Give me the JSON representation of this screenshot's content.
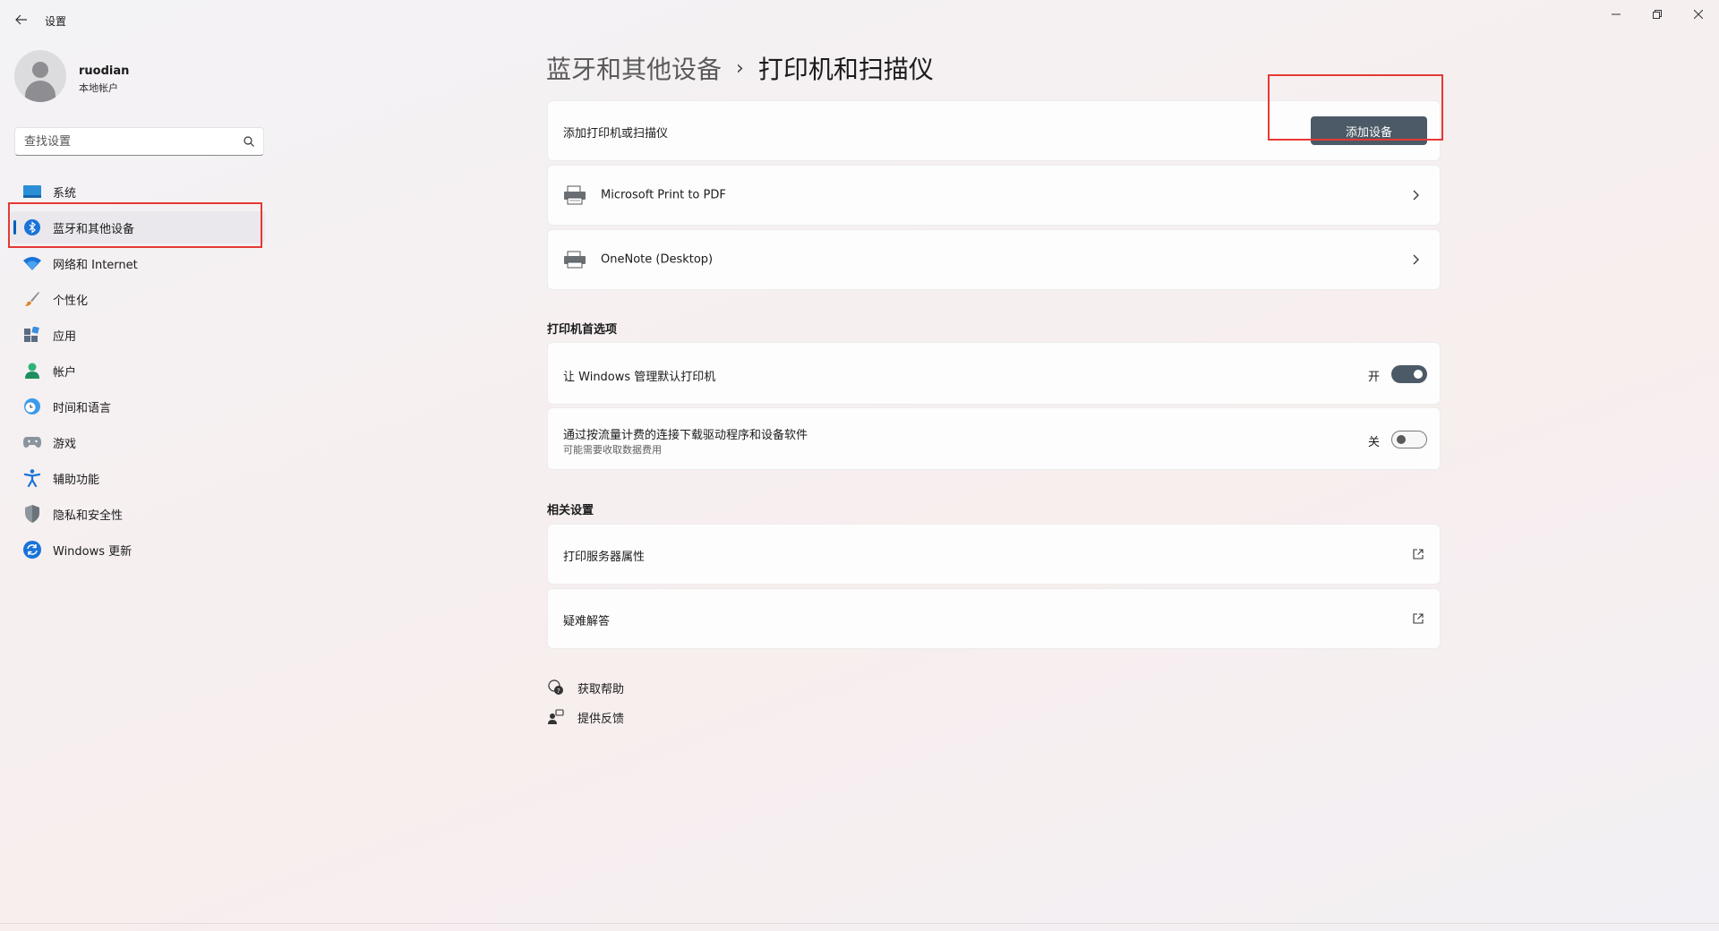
{
  "window": {
    "title": "设置"
  },
  "profile": {
    "name": "ruodian",
    "account_type": "本地帐户"
  },
  "search": {
    "placeholder": "查找设置"
  },
  "sidebar": {
    "items": [
      {
        "label": "系统",
        "icon": "system-icon"
      },
      {
        "label": "蓝牙和其他设备",
        "icon": "bluetooth-icon",
        "active": true
      },
      {
        "label": "网络和 Internet",
        "icon": "wifi-icon"
      },
      {
        "label": "个性化",
        "icon": "brush-icon"
      },
      {
        "label": "应用",
        "icon": "apps-icon"
      },
      {
        "label": "帐户",
        "icon": "account-icon"
      },
      {
        "label": "时间和语言",
        "icon": "globe-clock-icon"
      },
      {
        "label": "游戏",
        "icon": "gamepad-icon"
      },
      {
        "label": "辅助功能",
        "icon": "accessibility-icon"
      },
      {
        "label": "隐私和安全性",
        "icon": "shield-icon"
      },
      {
        "label": "Windows 更新",
        "icon": "update-icon"
      }
    ]
  },
  "breadcrumb": {
    "parent": "蓝牙和其他设备",
    "separator": "›",
    "current": "打印机和扫描仪"
  },
  "add_printer": {
    "label": "添加打印机或扫描仪",
    "button": "添加设备"
  },
  "devices": [
    {
      "name": "Microsoft Print to PDF",
      "icon": "printer-icon"
    },
    {
      "name": "OneNote (Desktop)",
      "icon": "printer-icon"
    }
  ],
  "printer_prefs": {
    "title": "打印机首选项",
    "manage_default": {
      "label": "让 Windows 管理默认打印机",
      "state_label": "开",
      "on": true
    },
    "metered": {
      "label": "通过按流量计费的连接下载驱动程序和设备软件",
      "sublabel": "可能需要收取数据费用",
      "state_label": "关",
      "on": false
    }
  },
  "related": {
    "title": "相关设置",
    "items": [
      {
        "label": "打印服务器属性",
        "icon": "external-link-icon"
      },
      {
        "label": "疑难解答",
        "icon": "external-link-icon"
      }
    ]
  },
  "help": {
    "get_help": "获取帮助",
    "feedback": "提供反馈"
  },
  "colors": {
    "accent": "#005fb8",
    "button": "#4b5a66",
    "highlight": "#e53935"
  }
}
